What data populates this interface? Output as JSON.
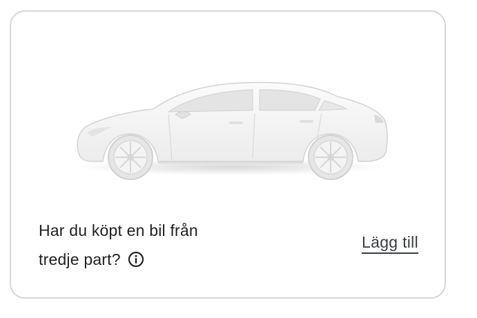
{
  "card": {
    "question_line1": "Har du köpt en bil från",
    "question_line2": "tredje part?",
    "add_label": "Lägg till"
  },
  "icons": {
    "info": "info-circle-icon",
    "car": "car-image"
  },
  "colors": {
    "text": "#222222",
    "link": "#393c41",
    "border": "#d6d6d6"
  }
}
